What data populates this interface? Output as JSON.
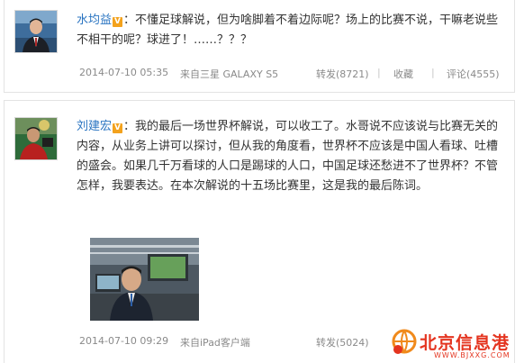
{
  "posts": [
    {
      "username": "水均益",
      "verified_badge": "V",
      "content": "：不懂足球解说，但为啥脚着不着边际呢？场上的比赛不说，干嘛老说些不相干的呢？球进了！……？？？",
      "timestamp": "2014-07-10 05:35",
      "source": "来自三星 GALAXY S5",
      "repost_label": "转发(8721)",
      "favorite_label": "收藏",
      "comment_label": "评论(4555)"
    },
    {
      "username": "刘建宏",
      "verified_badge": "V",
      "content": "：我的最后一场世界杯解说，可以收工了。水哥说不应该说与比赛无关的内容，从业务上讲可以探讨，但从我的角度看，世界杯不应该是中国人看球、吐槽的盛会。如果几千万看球的人口是踢球的人口，中国足球还愁进不了世界杯？不管怎样，我要表达。在本次解说的十五场比赛里，这是我的最后陈词。",
      "timestamp": "2014-07-10 09:29",
      "source": "来自iPad客户端",
      "repost_label": "转发(5024)"
    }
  ],
  "watermark": {
    "name": "北京信息港",
    "url": "WWW.BJXXG.COM"
  },
  "colors": {
    "link": "#2a74c1",
    "meta": "#8a8a8a",
    "badge": "#f3a21d",
    "watermark": "#e4341f"
  }
}
